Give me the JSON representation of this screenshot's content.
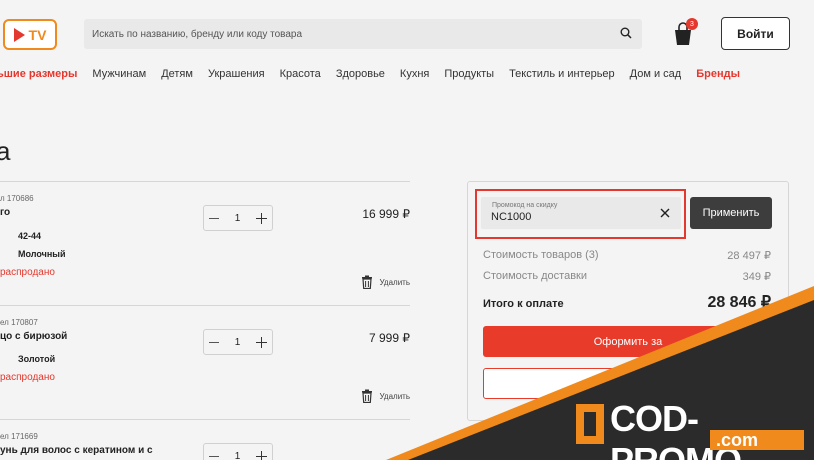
{
  "header": {
    "logo_text": "TV",
    "search_placeholder": "Искать по названию, бренду или коду товара",
    "cart_count": "3",
    "login_label": "Войти"
  },
  "nav": {
    "items": [
      "ьшие размеры",
      "Мужчинам",
      "Детям",
      "Украшения",
      "Красота",
      "Здоровье",
      "Кухня",
      "Продукты",
      "Текстиль и интерьер",
      "Дом и сад",
      "Бренды"
    ]
  },
  "page": {
    "title": "а"
  },
  "items": [
    {
      "art": "л 170686",
      "name": "го",
      "attr1": "42-44",
      "attr2": "Молочный",
      "status": "распродано",
      "qty": "1",
      "price": "16 999 ₽",
      "remove": "Удалить"
    },
    {
      "art": "ел 170807",
      "name": "цо с бирюзой",
      "attr1": "",
      "attr2": "Золотой",
      "status": "распродано",
      "qty": "1",
      "price": "7 999 ₽",
      "remove": "Удалить"
    },
    {
      "art": "ел 171669",
      "name": "унь для волос с кератином и с",
      "qty": "1"
    }
  ],
  "summary": {
    "promo_label": "Промокод на скидку",
    "promo_value": "NC1000",
    "apply_label": "Применить",
    "goods_label": "Стоимость товаров (3)",
    "goods_value": "28 497 ₽",
    "delivery_label": "Стоимость доставки",
    "delivery_value": "349 ₽",
    "total_label": "Итого к оплате",
    "total_value": "28 846 ₽",
    "checkout_label": "Оформить за"
  },
  "watermark": {
    "main": "COD-PROMO",
    "sub": ".com"
  },
  "colors": {
    "accent": "#e4382e",
    "orange": "#f08a1c",
    "dark": "#2b2b2b"
  }
}
